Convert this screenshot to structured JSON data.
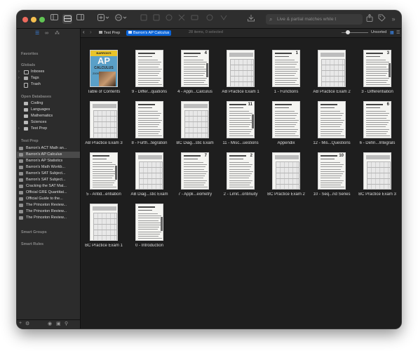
{
  "colors": {
    "close": "#ed6a5e",
    "minimize": "#f5bf4f",
    "zoom": "#61c554",
    "sidebar_selection": "#4a4a4a"
  },
  "toolbar": {
    "search_placeholder": "Live & partial matches while t",
    "icons": [
      "sidebar-toggle-icon",
      "view-options-icon",
      "inspector-icon",
      "new-item-icon",
      "actions-icon",
      "share-icon",
      "tag-icon"
    ]
  },
  "sidebar": {
    "favorites_header": "Favorites",
    "globals_header": "Globals",
    "globals": [
      {
        "label": "Inboxes",
        "icon": "inbox-icon"
      },
      {
        "label": "Tags",
        "icon": "tag-icon"
      },
      {
        "label": "Trash",
        "icon": "trash-icon"
      }
    ],
    "open_databases_header": "Open Databases",
    "databases": [
      {
        "label": "Coding",
        "icon": "database-icon"
      },
      {
        "label": "Languages",
        "icon": "database-icon"
      },
      {
        "label": "Mathematics",
        "icon": "database-icon"
      },
      {
        "label": "Sciences",
        "icon": "database-icon"
      },
      {
        "label": "Test Prep",
        "icon": "database-icon"
      }
    ],
    "test_prep_header": "Test Prep",
    "test_prep_items": [
      "Barron's ACT Math an...",
      "Barron's AP Calculus",
      "Barron's AP Statistics",
      "Barron's Math Workb...",
      "Barron's SAT Subject...",
      "Barron's SAT Subject...",
      "Cracking the SAT Mat...",
      "Official GRE Quantitat...",
      "Official Guide to the...",
      "The Princeton Review...",
      "The Princeton Review...",
      "The Princeton Review..."
    ],
    "smart_groups_header": "Smart Groups",
    "smart_rules_header": "Smart Rules"
  },
  "pathbar": {
    "crumb1": "Test Prep",
    "crumb2": "Barron's AP Calculus",
    "status": "28 items, 0 selected",
    "sort": "Unsorted"
  },
  "cover": {
    "top": "BARRON'S",
    "big": "AP",
    "sub": "CALCULUS",
    "year": "2009"
  },
  "items": [
    {
      "name": "Table of Contents",
      "page": ""
    },
    {
      "name": "9 - Differ...quations",
      "page": ""
    },
    {
      "name": "4 - Appli...Calculus",
      "page": "4"
    },
    {
      "name": "AB Practice Exam 1",
      "page": ""
    },
    {
      "name": "1 - Functions",
      "page": "1"
    },
    {
      "name": "AB Practice Exam 2",
      "page": ""
    },
    {
      "name": "3 - Differentiation",
      "page": "3"
    },
    {
      "name": "AB Practice Exam 3",
      "page": ""
    },
    {
      "name": "8 - Furth...tegration",
      "page": ""
    },
    {
      "name": "BC Diag...stic Exam",
      "page": ""
    },
    {
      "name": "11 - Misc...uestions",
      "page": "11"
    },
    {
      "name": "Appendix",
      "page": ""
    },
    {
      "name": "12 - Mis...Questions",
      "page": ""
    },
    {
      "name": "6 - Defin...Integrals",
      "page": "6"
    },
    {
      "name": "5 - Antid...entiation",
      "page": ""
    },
    {
      "name": "AB Diag...stic Exam",
      "page": ""
    },
    {
      "name": "7 - Appli...eometry",
      "page": "7"
    },
    {
      "name": "2 - Limit...ontinuity",
      "page": "2"
    },
    {
      "name": "BC Practice Exam 2",
      "page": ""
    },
    {
      "name": "10 - Seq...nd Series",
      "page": "10"
    },
    {
      "name": "BC Practice Exam 3",
      "page": ""
    },
    {
      "name": "BC Practice Exam 1",
      "page": ""
    },
    {
      "name": "0 - Introduction",
      "page": ""
    }
  ]
}
